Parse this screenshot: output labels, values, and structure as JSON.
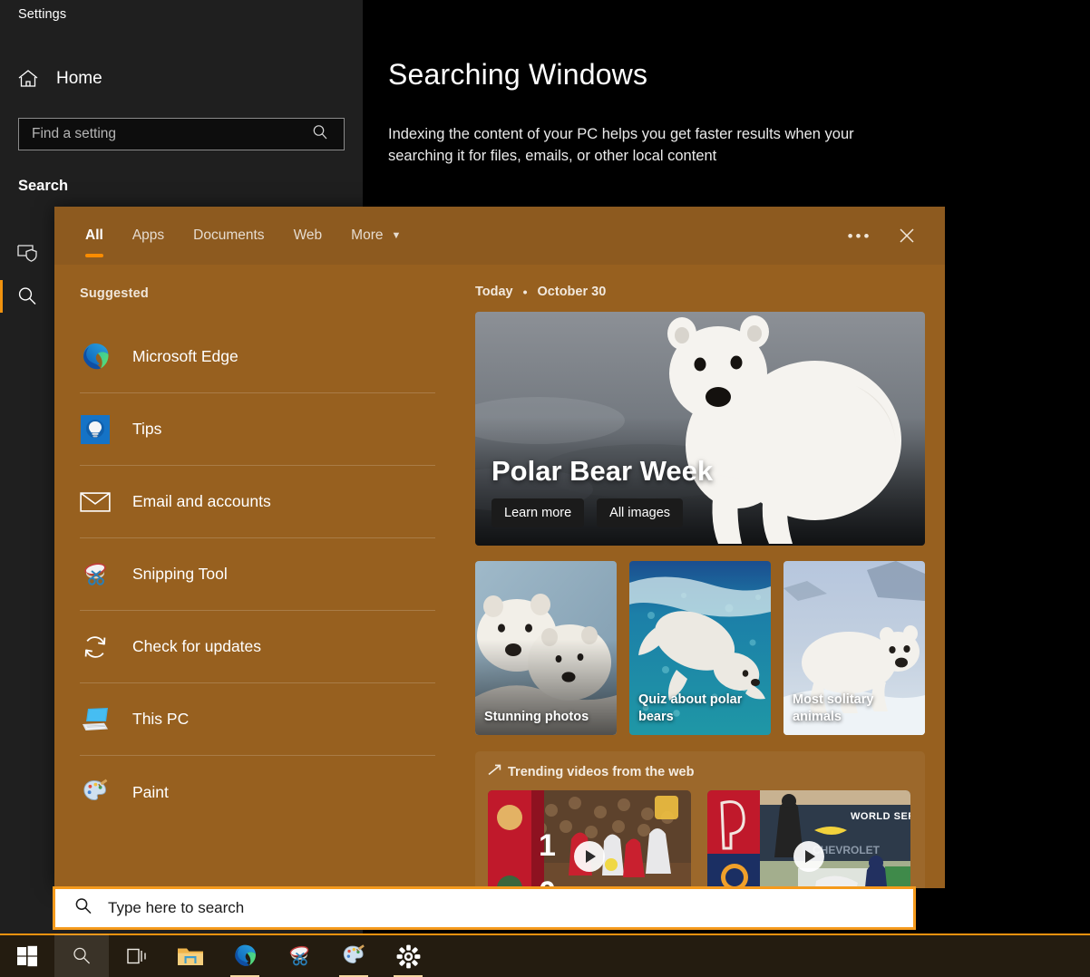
{
  "settings": {
    "window_title": "Settings",
    "home_label": "Home",
    "search_placeholder": "Find a setting",
    "search_value": "",
    "nav_section": "Search",
    "nav_icons": [
      {
        "name": "permissions-history-icon",
        "selected": false
      },
      {
        "name": "searching-windows-icon",
        "selected": true
      }
    ],
    "page_title": "Searching Windows",
    "page_description": "Indexing the content of your PC helps you get faster results when your searching it for files, emails, or other local content"
  },
  "search_panel": {
    "tabs": [
      {
        "label": "All",
        "active": true,
        "caret": false
      },
      {
        "label": "Apps",
        "active": false,
        "caret": false
      },
      {
        "label": "Documents",
        "active": false,
        "caret": false
      },
      {
        "label": "Web",
        "active": false,
        "caret": false
      },
      {
        "label": "More",
        "active": false,
        "caret": true
      }
    ],
    "more_options_label": "•••",
    "close_label": "✕",
    "suggested_heading": "Suggested",
    "suggested": [
      {
        "label": "Microsoft Edge",
        "icon": "edge-icon"
      },
      {
        "label": "Tips",
        "icon": "tips-icon"
      },
      {
        "label": "Email and accounts",
        "icon": "envelope-icon"
      },
      {
        "label": "Snipping Tool",
        "icon": "snipping-tool-icon"
      },
      {
        "label": "Check for updates",
        "icon": "refresh-icon"
      },
      {
        "label": "This PC",
        "icon": "this-pc-icon"
      },
      {
        "label": "Paint",
        "icon": "paint-icon"
      }
    ],
    "today_label": "Today",
    "today_separator": "•",
    "today_date": "October 30",
    "hero": {
      "title": "Polar Bear Week",
      "primary_button": "Learn more",
      "secondary_button": "All images",
      "image_alt": "polar bear standing on snow"
    },
    "cards": [
      {
        "caption": "Stunning photos",
        "image_alt": "two polar bears cuddling"
      },
      {
        "caption": "Quiz about polar bears",
        "image_alt": "polar bear swimming underwater"
      },
      {
        "caption": "Most solitary animals",
        "image_alt": "polar bear walking on ice"
      }
    ],
    "trending": {
      "heading": "Trending videos from the web",
      "videos": [
        {
          "alt": "soccer match highlight with score 1",
          "score": "1"
        },
        {
          "alt": "baseball world series highlight",
          "overlay_text": "WORLD SERIES"
        }
      ]
    }
  },
  "taskbar": {
    "search_placeholder": "Type here to search",
    "search_value": "",
    "items": [
      {
        "name": "start-button",
        "highlighted": false,
        "open": false
      },
      {
        "name": "taskbar-search-button",
        "highlighted": true,
        "open": false
      },
      {
        "name": "task-view-button",
        "highlighted": false,
        "open": false
      },
      {
        "name": "file-explorer-button",
        "highlighted": false,
        "open": false
      },
      {
        "name": "microsoft-edge-button",
        "highlighted": false,
        "open": true
      },
      {
        "name": "snipping-tool-button",
        "highlighted": false,
        "open": false
      },
      {
        "name": "paint-button",
        "highlighted": false,
        "open": true
      },
      {
        "name": "settings-button",
        "highlighted": false,
        "open": true
      }
    ]
  },
  "colors": {
    "accent_orange": "#f0920f",
    "panel_brown": "#97601f",
    "panel_header_brown": "#8d5a1f",
    "settings_nav_bg": "#1f1f1f",
    "taskbar_bg": "#241c10"
  }
}
